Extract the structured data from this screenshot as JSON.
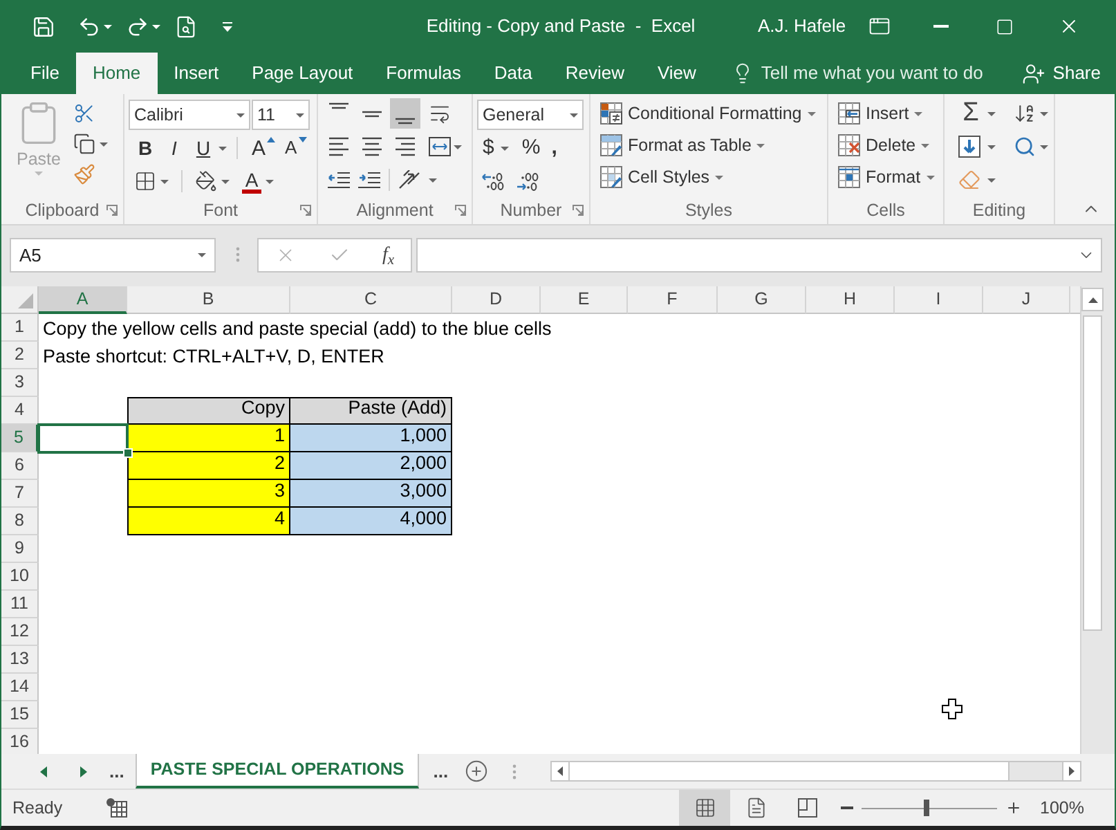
{
  "title_bar": {
    "title": "Editing - Copy and Paste  -  Excel",
    "user": "A.J. Hafele"
  },
  "tabs": [
    {
      "label": "File",
      "selected": false
    },
    {
      "label": "Home",
      "selected": true
    },
    {
      "label": "Insert",
      "selected": false
    },
    {
      "label": "Page Layout",
      "selected": false
    },
    {
      "label": "Formulas",
      "selected": false
    },
    {
      "label": "Data",
      "selected": false
    },
    {
      "label": "Review",
      "selected": false
    },
    {
      "label": "View",
      "selected": false
    }
  ],
  "tell_me": {
    "placeholder": "Tell me what you want to do"
  },
  "share": {
    "label": "Share"
  },
  "ribbon": {
    "groups": [
      {
        "kind": "clipboard",
        "label": "Clipboard",
        "paste": {
          "label": "Paste",
          "disabled": true
        }
      },
      {
        "kind": "font",
        "label": "Font",
        "font_name": "Calibri",
        "font_size": "11",
        "style_buttons": [
          {
            "kind": "bold",
            "label": "B"
          },
          {
            "kind": "italic",
            "label": "I"
          },
          {
            "kind": "underline",
            "label": "U"
          }
        ],
        "size_buttons": [
          {
            "kind": "grow",
            "label": "A"
          },
          {
            "kind": "shrink",
            "label": "A"
          }
        ],
        "font_color_button": "A"
      },
      {
        "kind": "alignment",
        "label": "Alignment",
        "vertical": [
          {
            "kind": "top",
            "selected": false
          },
          {
            "kind": "middle",
            "selected": false
          },
          {
            "kind": "bottom",
            "selected": true
          }
        ],
        "horizontal": [
          {
            "kind": "left",
            "selected": false
          },
          {
            "kind": "center",
            "selected": false
          },
          {
            "kind": "right",
            "selected": false
          }
        ]
      },
      {
        "kind": "number",
        "label": "Number",
        "format": "General",
        "currency": "$",
        "percent": "%",
        "comma": ","
      },
      {
        "kind": "styles",
        "label": "Styles",
        "commands": [
          {
            "kind": "conditional",
            "label": "Conditional Formatting"
          },
          {
            "kind": "table",
            "label": "Format as Table"
          },
          {
            "kind": "cell_styles",
            "label": "Cell Styles"
          }
        ]
      },
      {
        "kind": "cells",
        "label": "Cells",
        "commands": [
          {
            "kind": "insert",
            "label": "Insert"
          },
          {
            "kind": "delete",
            "label": "Delete"
          },
          {
            "kind": "format",
            "label": "Format"
          }
        ]
      },
      {
        "kind": "editing",
        "label": "Editing",
        "autosum": "Σ"
      }
    ]
  },
  "formula_bar": {
    "name_box": "A5",
    "function_button": "f$_{x}$"
  },
  "sheet": {
    "columns": [
      {
        "label": "A",
        "selected": true
      },
      {
        "label": "B",
        "selected": false
      },
      {
        "label": "C",
        "selected": false
      },
      {
        "label": "D",
        "selected": false
      },
      {
        "label": "E",
        "selected": false
      },
      {
        "label": "F",
        "selected": false
      },
      {
        "label": "G",
        "selected": false
      },
      {
        "label": "H",
        "selected": false
      },
      {
        "label": "I",
        "selected": false
      },
      {
        "label": "J",
        "selected": false
      }
    ],
    "rows": [
      {
        "label": "1",
        "selected": false,
        "cells": [
          {
            "kind": "text",
            "text": "Copy the yellow cells and paste special (add) to the blue cells"
          }
        ]
      },
      {
        "label": "2",
        "selected": false,
        "cells": [
          {
            "kind": "text",
            "text": "Paste shortcut: CTRL+ALT+V, D, ENTER"
          }
        ]
      },
      {
        "label": "3",
        "selected": false
      },
      {
        "label": "4",
        "selected": false,
        "cells": [
          {},
          {
            "kind": "heading",
            "text": "Copy",
            "color": "#d9d9d9"
          },
          {
            "kind": "heading",
            "text": "Paste (Add)",
            "color": "#d9d9d9"
          }
        ]
      },
      {
        "label": "5",
        "selected": true,
        "cells": [
          {},
          {
            "kind": "number",
            "text": "1",
            "color": "#ffff00"
          },
          {
            "kind": "number",
            "text": "1,000",
            "color": "#bdd7ee"
          }
        ]
      },
      {
        "label": "6",
        "selected": false,
        "cells": [
          {},
          {
            "kind": "number",
            "text": "2",
            "color": "#ffff00"
          },
          {
            "kind": "number",
            "text": "2,000",
            "color": "#bdd7ee"
          }
        ]
      },
      {
        "label": "7",
        "selected": false,
        "cells": [
          {},
          {
            "kind": "number",
            "text": "3",
            "color": "#ffff00"
          },
          {
            "kind": "number",
            "text": "3,000",
            "color": "#bdd7ee"
          }
        ]
      },
      {
        "label": "8",
        "selected": false,
        "cells": [
          {},
          {
            "kind": "number",
            "text": "4",
            "color": "#ffff00"
          },
          {
            "kind": "number",
            "text": "4,000",
            "color": "#bdd7ee"
          }
        ]
      },
      {
        "label": "9",
        "selected": false
      },
      {
        "label": "10",
        "selected": false
      },
      {
        "label": "11",
        "selected": false
      },
      {
        "label": "12",
        "selected": false
      },
      {
        "label": "13",
        "selected": false
      },
      {
        "label": "14",
        "selected": false
      },
      {
        "label": "15",
        "selected": false
      },
      {
        "label": "16",
        "selected": false
      }
    ]
  },
  "sheet_tabs": {
    "more_before": "...",
    "tabs": [
      {
        "label": "PASTE SPECIAL OPERATIONS",
        "selected": true
      }
    ],
    "more_after": "..."
  },
  "status_bar": {
    "status": "Ready",
    "views": [
      {
        "kind": "normal",
        "selected": true
      },
      {
        "kind": "page_layout",
        "selected": false
      },
      {
        "kind": "page_break",
        "selected": false
      }
    ],
    "zoom": {
      "level": 0.48,
      "reading": "100%"
    }
  }
}
